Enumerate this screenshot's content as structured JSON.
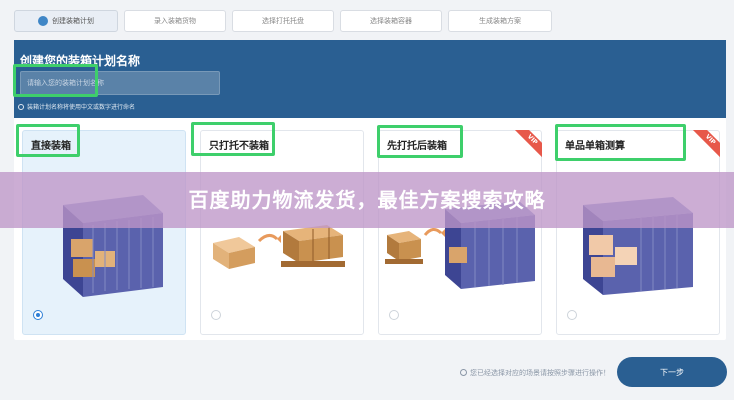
{
  "steps": [
    {
      "label": "创建装箱计划"
    },
    {
      "label": "录入装箱货物"
    },
    {
      "label": "选择打托托盘"
    },
    {
      "label": "选择装箱容器"
    },
    {
      "label": "生成装箱方案"
    }
  ],
  "plan": {
    "title": "创建您的装箱计划名称",
    "placeholder": "请输入您的装箱计划名称",
    "hint": "装箱计划名称将使用中文或数字进行命名"
  },
  "cards": [
    {
      "label": "直接装箱",
      "selected": true,
      "vip": false
    },
    {
      "label": "只打托不装箱",
      "selected": false,
      "vip": false
    },
    {
      "label": "先打托后装箱",
      "selected": false,
      "vip": true
    },
    {
      "label": "单品单箱测算",
      "selected": false,
      "vip": true
    }
  ],
  "vip_label": "VIP",
  "banner": {
    "text": "百度助力物流发货，最佳方案搜索攻略"
  },
  "footer": {
    "tip": "您已经选择对应的场景请按照步骤进行操作！",
    "next_label": "下一步"
  },
  "colors": {
    "header": "#2a5f92",
    "highlight": "#3ecf6b",
    "vip": "#e7584a",
    "accent": "#2e7fd6"
  }
}
